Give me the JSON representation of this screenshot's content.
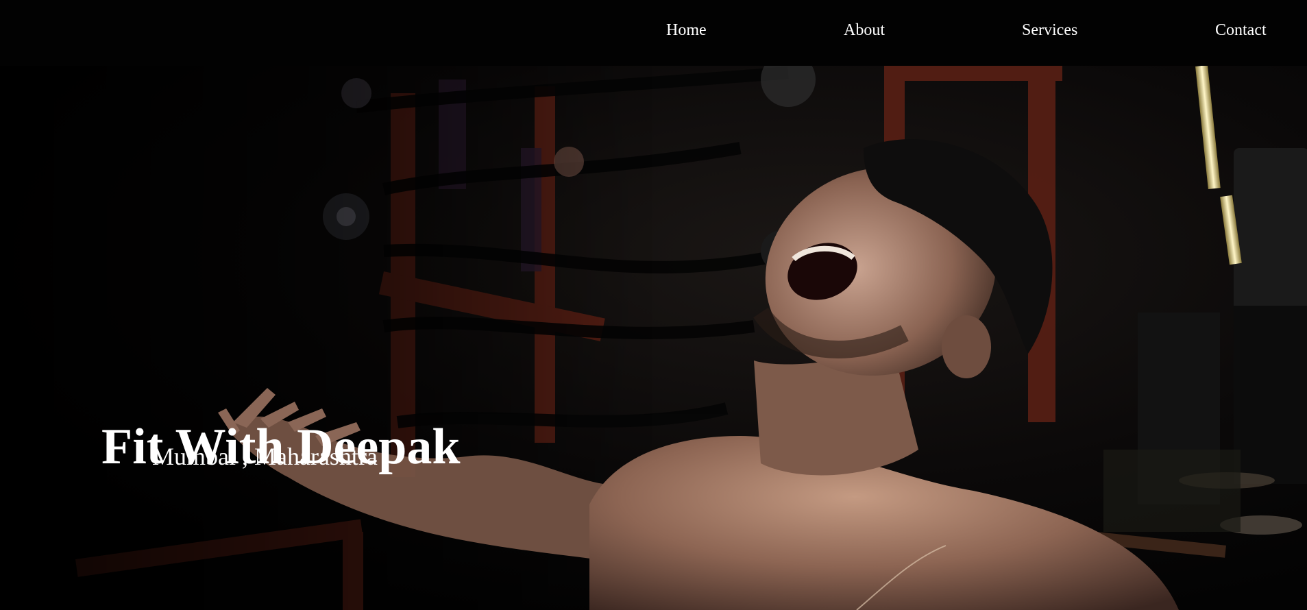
{
  "nav": {
    "items": [
      {
        "label": "Home"
      },
      {
        "label": "About"
      },
      {
        "label": "Services"
      },
      {
        "label": "Contact"
      }
    ]
  },
  "hero": {
    "title": "Fit With Deepak",
    "subtitle": "Mumbai , Maharashtra",
    "background_image": "athlete-gym-photo"
  },
  "colors": {
    "nav_background": "#020202",
    "text": "#ffffff",
    "hero_dark": "#060505",
    "gym_red": "#7a2a18",
    "skin": "#a8806a"
  }
}
